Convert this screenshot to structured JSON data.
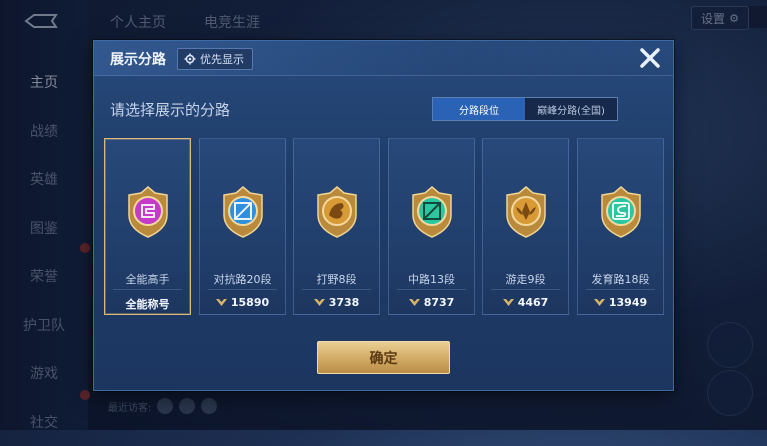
{
  "background": {
    "sidebar": [
      {
        "label": "主页",
        "active": true
      },
      {
        "label": "战绩"
      },
      {
        "label": "英雄"
      },
      {
        "label": "图鉴"
      },
      {
        "label": "荣誉"
      },
      {
        "label": "护卫队"
      },
      {
        "label": "游戏"
      },
      {
        "label": "社交"
      }
    ],
    "top_tabs": [
      "个人主页",
      "电竞生涯"
    ],
    "settings_label": "设置",
    "visitors_label": "最近访客:"
  },
  "dialog": {
    "title": "展示分路",
    "priority_button": "优先显示",
    "prompt": "请选择展示的分路",
    "toggle": [
      {
        "label": "分路段位",
        "active": true
      },
      {
        "label": "巅峰分路(全国)",
        "active": false
      }
    ],
    "cards": [
      {
        "name": "全能高手",
        "value": "全能称号",
        "selected": true,
        "emblem": "all-round-emblem-icon",
        "color": "#c53bc9"
      },
      {
        "name": "对抗路20段",
        "value": "15890",
        "selected": false,
        "emblem": "clash-lane-emblem-icon",
        "color": "#2f8fe0"
      },
      {
        "name": "打野8段",
        "value": "3738",
        "selected": false,
        "emblem": "jungle-emblem-icon",
        "color": "#d89a35"
      },
      {
        "name": "中路13段",
        "value": "8737",
        "selected": false,
        "emblem": "mid-lane-emblem-icon",
        "color": "#2cc7a0"
      },
      {
        "name": "游走9段",
        "value": "4467",
        "selected": false,
        "emblem": "roam-emblem-icon",
        "color": "#d89a35"
      },
      {
        "name": "发育路18段",
        "value": "13949",
        "selected": false,
        "emblem": "farm-lane-emblem-icon",
        "color": "#2cc7a0"
      }
    ],
    "confirm_label": "确定"
  }
}
